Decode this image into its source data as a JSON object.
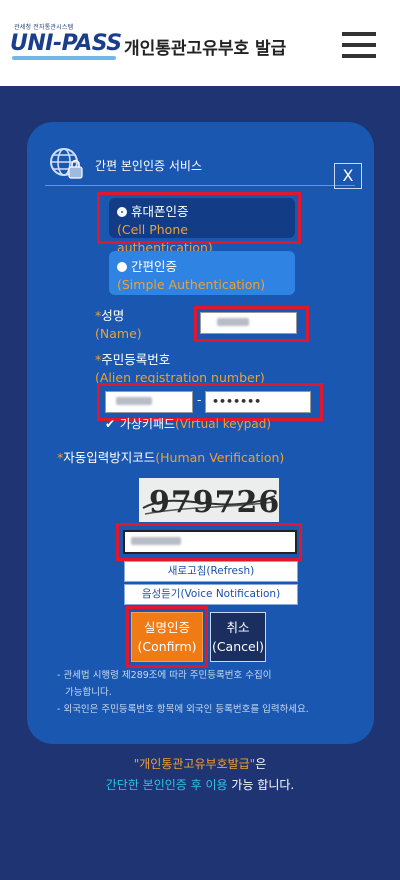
{
  "header": {
    "logo_sub": "관세청 전자통관시스템",
    "logo_text": "UNI-PASS",
    "title": "개인통관고유부호 발급",
    "menu_icon": "hamburger-menu-icon"
  },
  "modal": {
    "title": "간편 본인인증 서비스",
    "close_label": "X",
    "options": [
      {
        "label": "휴대폰인증",
        "sub": "(Cell Phone authentication)",
        "selected": true
      },
      {
        "label": "간편인증",
        "sub": "(Simple Authentication)",
        "selected": false
      }
    ],
    "name": {
      "required_mark": "*",
      "label": "성명",
      "sub": "(Name)"
    },
    "reg": {
      "required_mark": "*",
      "label": "주민등록번호",
      "sub": "(Alien registration number)",
      "separator": "-",
      "back_masked": "•••••••"
    },
    "keypad": {
      "label": "가상키패드",
      "sub": "(Virtual keypad)",
      "checked": true
    },
    "captcha": {
      "required_mark": "*",
      "label": "자동입력방지코드",
      "sub": "(Human Verification)",
      "code": "979726"
    },
    "refresh_label": "새로고침(Refresh)",
    "voice_label": "음성듣기(Voice Notification)",
    "confirm": {
      "label": "실명인증",
      "sub": "(Confirm)"
    },
    "cancel": {
      "label": "취소",
      "sub": "(Cancel)"
    },
    "notes": [
      "- 관세법 시행령 제289조에 따라 주민등록번호 수집이",
      "가능합니다.",
      "- 외국인은 주민등록번호 항목에 외국인 등록번호를 입력하세요."
    ]
  },
  "footer": {
    "quote": "\"개인통관고유부호발급\"",
    "suffix1": "은",
    "blue": "간단한 본인인증 후 이용",
    "suffix2": " 가능 합니다."
  },
  "colors": {
    "page_bg": "#1e3473",
    "modal_bg": "#1a57b0",
    "highlight": "#e0182e",
    "accent_orange": "#f07b14",
    "accent_cyan": "#2fc3e8"
  }
}
